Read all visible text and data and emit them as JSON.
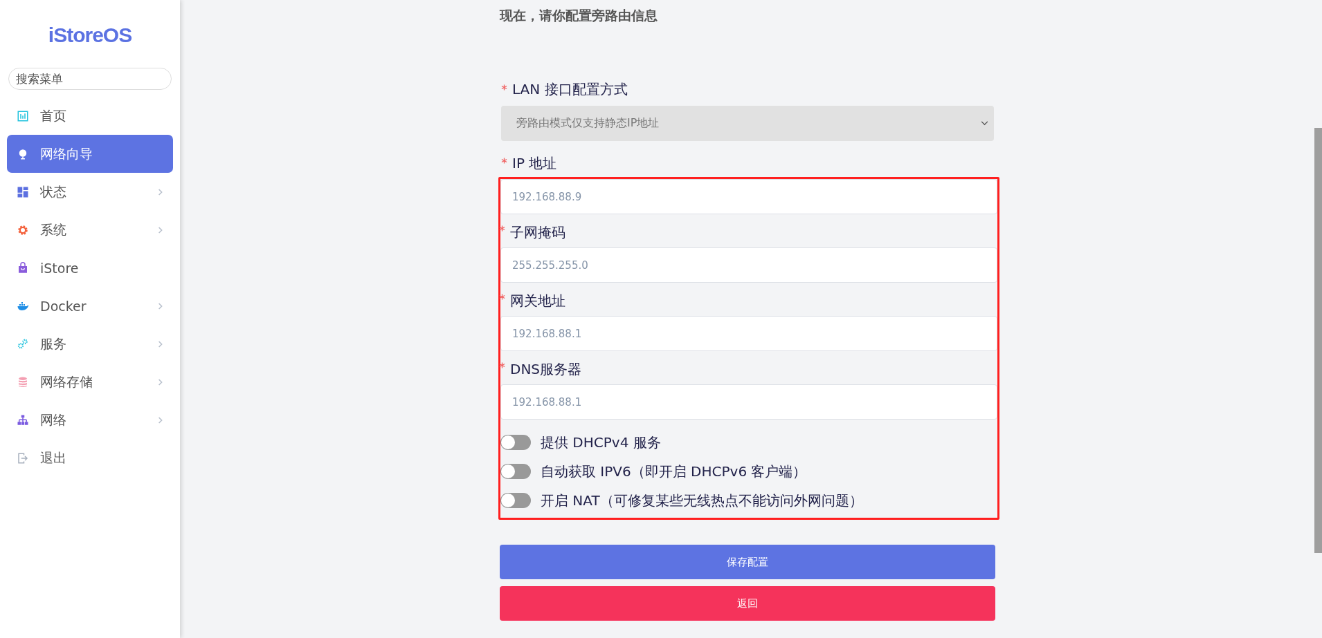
{
  "sidebar": {
    "logo": "iStoreOS",
    "search": {
      "placeholder": "搜索菜单"
    },
    "items": [
      {
        "label": "首页",
        "kind": "chart",
        "selected": false,
        "expandable": false
      },
      {
        "label": "网络向导",
        "kind": "globe",
        "selected": true,
        "expandable": false
      },
      {
        "label": "状态",
        "kind": "dashboard",
        "selected": false,
        "expandable": true
      },
      {
        "label": "系统",
        "kind": "gear",
        "selected": false,
        "expandable": true
      },
      {
        "label": "iStore",
        "kind": "bag",
        "selected": false,
        "expandable": false
      },
      {
        "label": "Docker",
        "kind": "whale",
        "selected": false,
        "expandable": true
      },
      {
        "label": "服务",
        "kind": "gears",
        "selected": false,
        "expandable": true
      },
      {
        "label": "网络存储",
        "kind": "database",
        "selected": false,
        "expandable": true
      },
      {
        "label": "网络",
        "kind": "tree",
        "selected": false,
        "expandable": true
      },
      {
        "label": "退出",
        "kind": "exit",
        "selected": false,
        "expandable": false
      }
    ]
  },
  "form": {
    "title": "现在，请你配置旁路由信息",
    "mode": {
      "label": "LAN 接口配置方式",
      "required": true,
      "value": "旁路由模式仅支持静态IP地址",
      "disabled": true
    },
    "highlighted": {
      "fields": [
        {
          "label": "IP 地址",
          "required": true,
          "value": "192.168.88.9"
        },
        {
          "label": "子网掩码",
          "required": true,
          "value": "255.255.255.0"
        },
        {
          "label": "网关地址",
          "required": true,
          "value": "192.168.88.1"
        },
        {
          "label": "DNS服务器",
          "required": true,
          "value": "192.168.88.1"
        }
      ],
      "switches": [
        {
          "label": "提供 DHCPv4 服务",
          "on": false
        },
        {
          "label": "自动获取 IPV6（即开启 DHCPv6 客户端）",
          "on": false
        },
        {
          "label": "开启 NAT（可修复某些无线热点不能访问外网问题）",
          "on": false
        }
      ]
    },
    "buttons": [
      {
        "label": "保存配置",
        "kind": "primary"
      },
      {
        "label": "返回",
        "kind": "danger"
      }
    ]
  }
}
